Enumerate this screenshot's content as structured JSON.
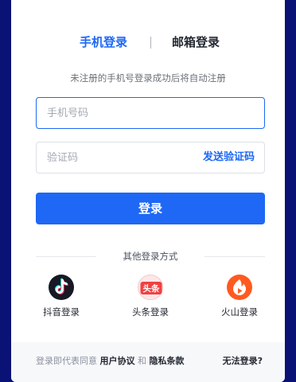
{
  "tabs": {
    "phone_login": "手机登录",
    "email_login": "邮箱登录"
  },
  "hint": "未注册的手机号登录成功后将自动注册",
  "phone_field": {
    "placeholder": "手机号码",
    "value": ""
  },
  "code_field": {
    "placeholder": "验证码",
    "value": "",
    "send_label": "发送验证码"
  },
  "login_button": "登录",
  "other_login": {
    "title": "其他登录方式",
    "items": [
      {
        "label": "抖音登录",
        "icon": "douyin-icon"
      },
      {
        "label": "头条登录",
        "icon": "toutiao-icon",
        "icon_text": "头条"
      },
      {
        "label": "火山登录",
        "icon": "huoshan-icon"
      }
    ]
  },
  "footer": {
    "agree_prefix": "登录即代表同意",
    "user_agreement": "用户协议",
    "and": "和",
    "privacy_policy": "隐私条款",
    "cant_login": "无法登录?"
  },
  "colors": {
    "accent": "#1e68f5",
    "background": "#0b1275"
  }
}
